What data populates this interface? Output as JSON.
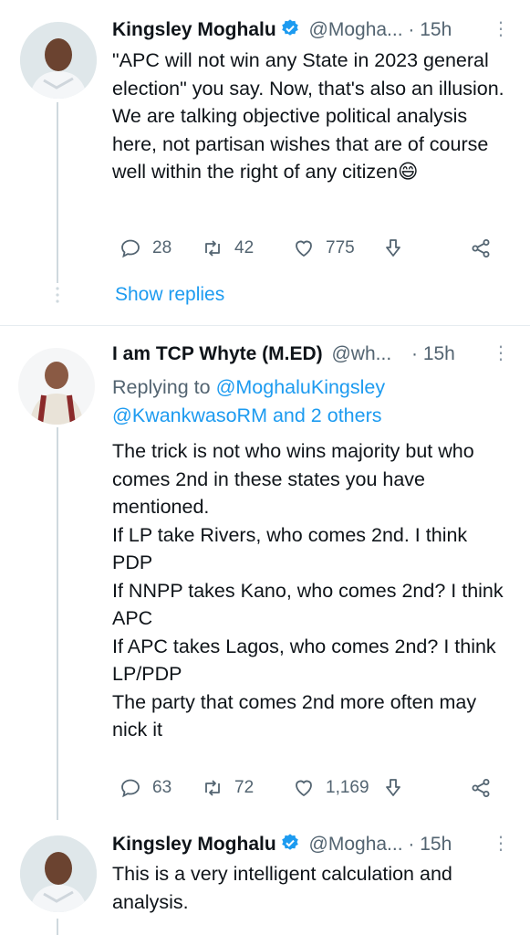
{
  "tweets": [
    {
      "name": "Kingsley Moghalu",
      "handle": "@Mogha...",
      "time": "· 15h",
      "text": "\"APC will not win any State in 2023 general election\" you say. Now, that's also an illusion. We are talking objective political analysis here, not partisan wishes that are of course well within the right of any citizen😄",
      "replies": "28",
      "retweets": "42",
      "likes": "775"
    },
    {
      "name": "I am TCP Whyte (M.ED)",
      "handle": "@wh...",
      "time": "· 15h",
      "replying_label": "Replying to",
      "replying_user1": "@MoghaluKingsley",
      "replying_user2": "@KwankwasoRM and 2 others",
      "text": "The trick is not who wins majority but who comes 2nd in these states you have mentioned.\nIf LP take Rivers, who comes 2nd. I think PDP\nIf NNPP takes Kano, who comes 2nd? I think APC\nIf APC takes Lagos, who comes 2nd? I think LP/PDP\nThe party that comes 2nd more often may nick it",
      "replies": "63",
      "retweets": "72",
      "likes": "1,169"
    },
    {
      "name": "Kingsley Moghalu",
      "handle": "@Mogha...",
      "time": "· 15h",
      "text": "This is a very intelligent calculation and analysis."
    }
  ],
  "show_replies": "Show replies",
  "colors": {
    "link": "#1d9bf0",
    "secondary": "#536471",
    "verified": "#1d9bf0",
    "line": "#cfd9de"
  },
  "icons": [
    "verified-badge-icon",
    "more-icon",
    "reply-icon",
    "retweet-icon",
    "like-icon",
    "views-icon",
    "share-icon"
  ]
}
